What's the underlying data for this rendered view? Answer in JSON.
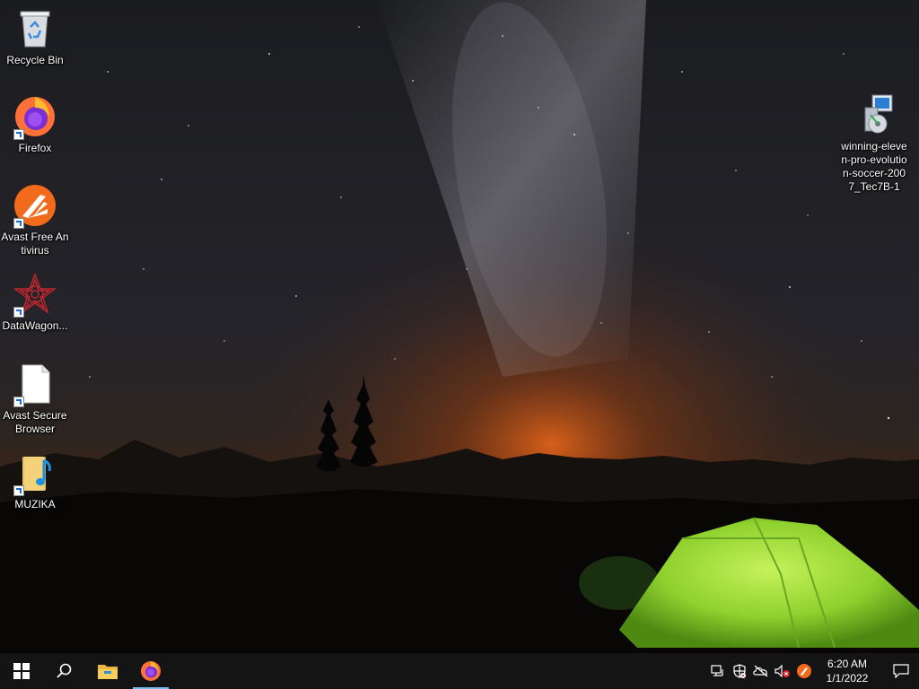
{
  "desktop": {
    "icons": [
      {
        "label": "Recycle Bin"
      },
      {
        "label": "Firefox"
      },
      {
        "label": "Avast Free Antivirus"
      },
      {
        "label": "DataWagon..."
      },
      {
        "label": "Avast Secure Browser"
      },
      {
        "label": "MUZIKA"
      },
      {
        "label": "winning-eleven-pro-evolution-soccer-2007_Tec7B-1"
      }
    ]
  },
  "taskbar": {
    "pinned": [
      {
        "icon": "windows-start-icon"
      },
      {
        "icon": "search-icon"
      },
      {
        "icon": "file-explorer-icon"
      },
      {
        "icon": "firefox-icon"
      }
    ],
    "tray": {
      "icons": [
        "network-icon",
        "windows-security-icon",
        "onedrive-offline-icon",
        "volume-muted-icon",
        "avast-tray-icon"
      ],
      "time": "6:20 AM",
      "date": "1/1/2022"
    }
  },
  "colors": {
    "taskbar_bg": "#141414",
    "tent_green": "#8fd12e",
    "sunset_orange": "#e0621a",
    "firefox_orange": "#ff7139",
    "avast_orange": "#f26b1d"
  }
}
